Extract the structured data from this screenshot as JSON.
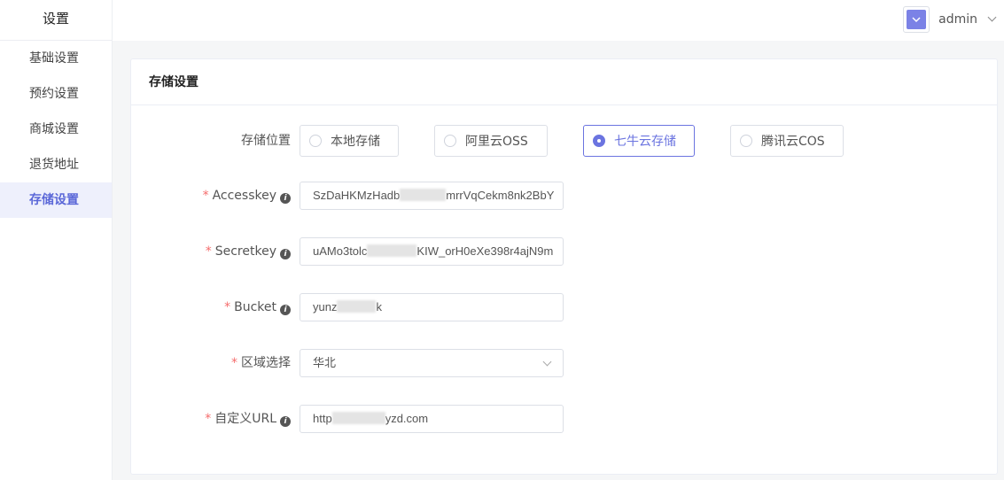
{
  "sidebar": {
    "title": "设置",
    "items": [
      {
        "label": "基础设置"
      },
      {
        "label": "预约设置"
      },
      {
        "label": "商城设置"
      },
      {
        "label": "退货地址"
      },
      {
        "label": "存储设置"
      }
    ]
  },
  "topbar": {
    "username": "admin"
  },
  "card": {
    "title": "存储设置",
    "storage_location_label": "存储位置",
    "options": [
      {
        "label": "本地存储",
        "checked": false
      },
      {
        "label": "阿里云OSS",
        "checked": false
      },
      {
        "label": "七牛云存储",
        "checked": true
      },
      {
        "label": "腾讯云COS",
        "checked": false
      }
    ],
    "fields": {
      "accesskey": {
        "label": "Accesskey",
        "value_start": "SzDaHKMzHadb",
        "value_end": "mrrVqCekm8nk2BbY"
      },
      "secretkey": {
        "label": "Secretkey",
        "value_start": "uAMo3tolc",
        "value_end": "KIW_orH0eXe398r4ajN9m"
      },
      "bucket": {
        "label": "Bucket",
        "value_start": "yunz",
        "value_end": "k"
      },
      "region": {
        "label": "区域选择",
        "value": "华北"
      },
      "custom_url": {
        "label": "自定义URL",
        "value_start": "http",
        "value_end": "yzd.com"
      }
    }
  },
  "colors": {
    "accent": "#6b74e0",
    "required": "#f56c6c"
  }
}
